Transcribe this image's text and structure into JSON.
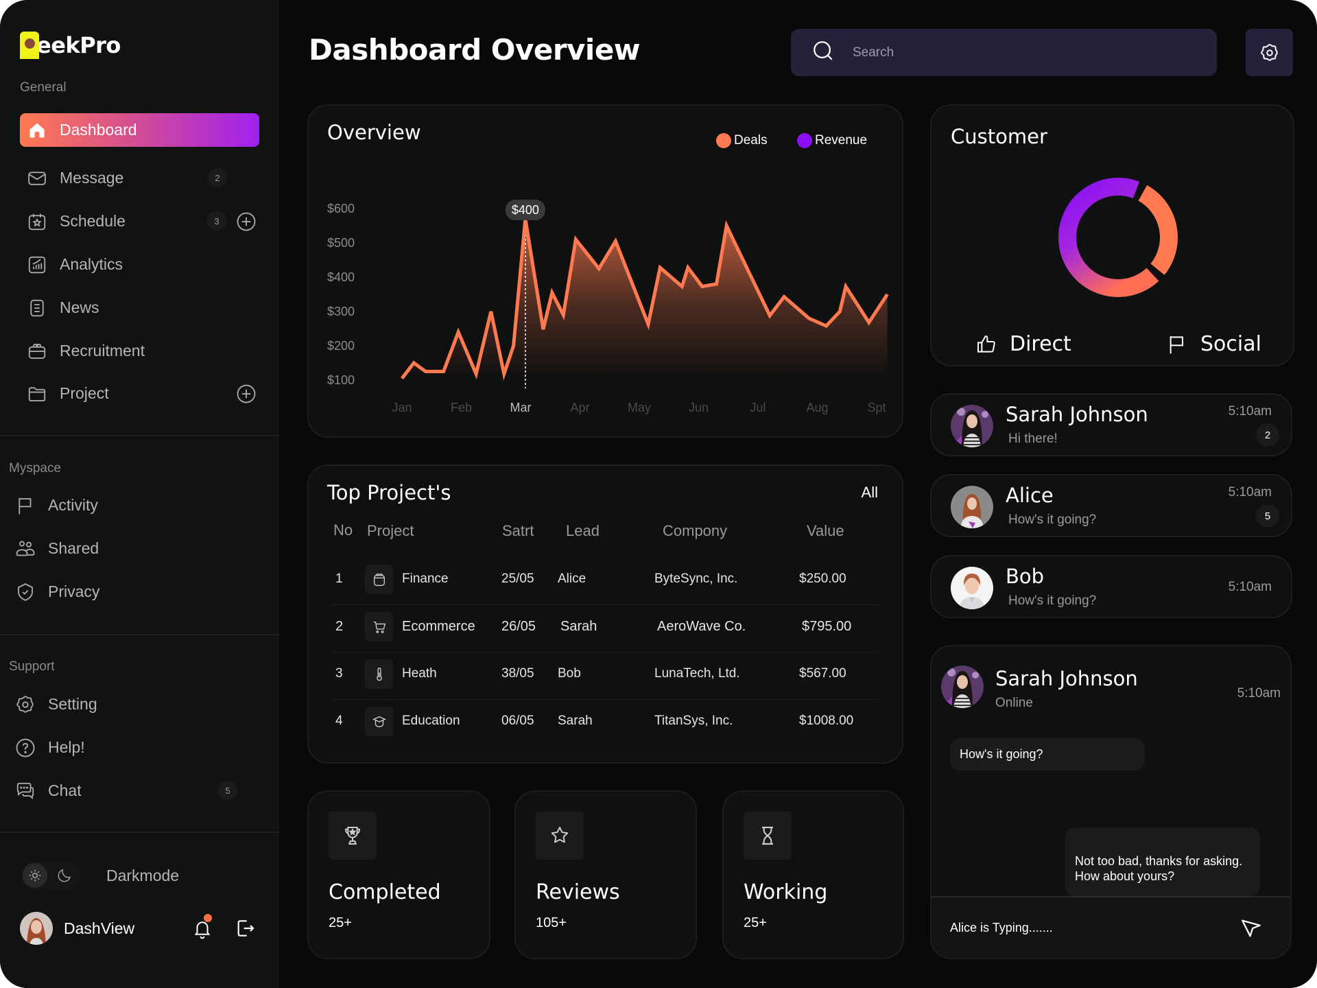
{
  "brand": {
    "name": "eekPro"
  },
  "sidebar": {
    "general_label": "General",
    "general": [
      {
        "label": "Dashboard",
        "icon": "home-icon",
        "active": true
      },
      {
        "label": "Message",
        "icon": "mail-icon",
        "badge": "2"
      },
      {
        "label": "Schedule",
        "icon": "calendar-star-icon",
        "badge": "3",
        "add": true
      },
      {
        "label": "Analytics",
        "icon": "analytics-icon"
      },
      {
        "label": "News",
        "icon": "news-icon"
      },
      {
        "label": "Recruitment",
        "icon": "briefcase-icon"
      },
      {
        "label": "Project",
        "icon": "folder-icon",
        "add": true
      }
    ],
    "myspace_label": "Myspace",
    "myspace": [
      {
        "label": "Activity",
        "icon": "flag-icon"
      },
      {
        "label": "Shared",
        "icon": "users-icon"
      },
      {
        "label": "Privacy",
        "icon": "shield-check-icon"
      }
    ],
    "support_label": "Support",
    "support": [
      {
        "label": "Setting",
        "icon": "gear-icon"
      },
      {
        "label": "Help!",
        "icon": "help-icon"
      },
      {
        "label": "Chat",
        "icon": "chat-icon",
        "badge": "5"
      }
    ],
    "darkmode_label": "Darkmode",
    "user_name": "DashView"
  },
  "header": {
    "title": "Dashboard Overview",
    "search_placeholder": "Search"
  },
  "overview": {
    "title": "Overview",
    "tooltip": "$400",
    "legend": [
      {
        "label": "Deals",
        "color": "#ff7a50"
      },
      {
        "label": "Revenue",
        "color": "#8a0ff5"
      }
    ]
  },
  "chart_data": {
    "type": "area",
    "title": "Overview",
    "xlabel": "",
    "ylabel": "",
    "x_ticks": [
      "Jan",
      "Feb",
      "Mar",
      "Apr",
      "May",
      "Jun",
      "Jul",
      "Aug",
      "Spt"
    ],
    "highlighted_tick": "Mar",
    "y_ticks": [
      "$100",
      "$200",
      "$300",
      "$400",
      "$500",
      "$600"
    ],
    "ylim": [
      100,
      600
    ],
    "grid": false,
    "legend_position": "top-right",
    "series": [
      {
        "name": "Deals",
        "color": "#ff7a50",
        "x": [
          0,
          0.2,
          0.4,
          0.7,
          0.95,
          1.25,
          1.5,
          1.72,
          1.88,
          2.08,
          2.38,
          2.53,
          2.72,
          2.93,
          3.32,
          3.6,
          4.15,
          4.35,
          4.72,
          4.82,
          5.06,
          5.3,
          5.47,
          6.2,
          6.44,
          6.86,
          7.15,
          7.38,
          7.48,
          7.87,
          8.18
        ],
        "values": [
          105,
          150,
          125,
          125,
          240,
          118,
          300,
          118,
          200,
          570,
          248,
          355,
          290,
          510,
          425,
          505,
          263,
          428,
          373,
          428,
          373,
          380,
          550,
          288,
          343,
          280,
          258,
          300,
          373,
          268,
          350
        ]
      },
      {
        "name": "Revenue",
        "color": "#8a0ff5",
        "values": []
      }
    ],
    "annotations": [
      {
        "x": 2.08,
        "label": "$400"
      }
    ]
  },
  "customer": {
    "title": "Customer",
    "segments": [
      {
        "label": "Direct",
        "icon": "thumbs-up-icon",
        "share": 0.7
      },
      {
        "label": "Social",
        "icon": "flag-icon",
        "share": 0.3
      }
    ]
  },
  "projects": {
    "title": "Top Project's",
    "all_label": "All",
    "columns": [
      "No",
      "Project",
      "Satrt",
      "Lead",
      "Compony",
      "Value"
    ],
    "rows": [
      {
        "no": "1",
        "project": "Finance",
        "icon": "wallet-icon",
        "start": "25/05",
        "lead": "Alice",
        "company": "ByteSync, Inc.",
        "value": "$250.00"
      },
      {
        "no": "2",
        "project": "Ecommerce",
        "icon": "cart-icon",
        "start": "26/05",
        "lead": "Sarah",
        "company": "AeroWave Co.",
        "value": "$795.00"
      },
      {
        "no": "3",
        "project": "Heath",
        "icon": "thermometer-icon",
        "start": "38/05",
        "lead": "Bob",
        "company": "LunaTech, Ltd.",
        "value": "$567.00"
      },
      {
        "no": "4",
        "project": "Education",
        "icon": "graduation-cap-icon",
        "start": "06/05",
        "lead": "Sarah",
        "company": "TitanSys, Inc.",
        "value": "$1008.00"
      }
    ]
  },
  "stats": [
    {
      "title": "Completed",
      "value": "25+",
      "icon": "trophy-icon"
    },
    {
      "title": "Reviews",
      "value": "105+",
      "icon": "star-icon"
    },
    {
      "title": "Working",
      "value": "25+",
      "icon": "hourglass-icon"
    }
  ],
  "chats": [
    {
      "name": "Sarah Johnson",
      "message": "Hi there!",
      "time": "5:10am",
      "unread": "2"
    },
    {
      "name": "Alice",
      "message": "How's it going?",
      "time": "5:10am",
      "unread": "5"
    },
    {
      "name": "Bob",
      "message": "How's it going?",
      "time": "5:10am",
      "unread": null
    }
  ],
  "conversation": {
    "name": "Sarah Johnson",
    "status": "Online",
    "time": "5:10am",
    "incoming": "How's it going?",
    "outgoing": "Not too bad, thanks for asking. How about yours?",
    "typing": "Alice is Typing......."
  },
  "colors": {
    "accent_orange": "#ff7a50",
    "accent_purple": "#8a0ff5",
    "search_bg": "#24213a"
  }
}
